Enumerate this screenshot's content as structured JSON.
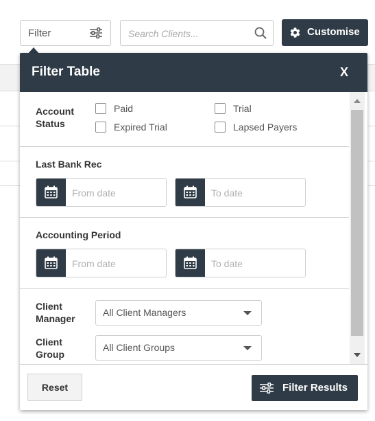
{
  "toolbar": {
    "filter_label": "Filter",
    "search_placeholder": "Search Clients...",
    "customise_label": "Customise"
  },
  "panel": {
    "title": "Filter Table",
    "close_label": "X",
    "account_status": {
      "label_line1": "Account",
      "label_line2": "Status",
      "options": [
        "Paid",
        "Trial",
        "Expired Trial",
        "Lapsed Payers"
      ]
    },
    "last_bank_rec": {
      "label": "Last Bank Rec",
      "from_placeholder": "From date",
      "to_placeholder": "To date"
    },
    "accounting_period": {
      "label": "Accounting Period",
      "from_placeholder": "From date",
      "to_placeholder": "To date"
    },
    "client_manager": {
      "label_line1": "Client",
      "label_line2": "Manager",
      "value": "All Client Managers"
    },
    "client_group": {
      "label_line1": "Client",
      "label_line2": "Group",
      "value": "All Client Groups"
    },
    "reset_label": "Reset",
    "apply_label": "Filter Results"
  },
  "icons": {
    "filter": "sliders-icon",
    "search": "search-icon",
    "customise": "gear-icon",
    "date": "calendar-icon"
  },
  "colors": {
    "header": "#2f3b46",
    "button_dark": "#2f3b46"
  }
}
